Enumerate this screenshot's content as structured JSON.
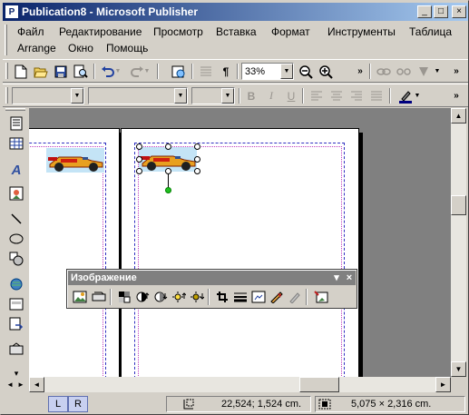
{
  "window": {
    "title": "Publication8 - Microsoft Publisher",
    "app_icon": "publisher-icon",
    "controls": {
      "minimize": "_",
      "maximize": "□",
      "close": "×"
    }
  },
  "menu": {
    "items": [
      "Файл",
      "Редактирование",
      "Просмотр",
      "Вставка",
      "Формат",
      "Инструменты",
      "Таблица",
      "Arrange",
      "Окно",
      "Помощь"
    ]
  },
  "standard_toolbar": {
    "zoom": "33%",
    "icons": [
      "new-icon",
      "open-icon",
      "save-icon",
      "print-preview-icon",
      "undo-icon",
      "redo-icon",
      "web-preview-icon",
      "columns-icon",
      "pilcrow-icon",
      "zoom-out-icon",
      "zoom-in-icon",
      "more-icon",
      "link-icon",
      "unlink-icon",
      "text-connect-icon"
    ]
  },
  "formatting_toolbar": {
    "style_value": "",
    "font_value": "",
    "size_value": "",
    "bold": "B",
    "italic": "I",
    "underline": "U"
  },
  "picture_toolbar": {
    "title": "Изображение",
    "menu_arrow": "▾",
    "close": "×"
  },
  "statusbar": {
    "page_tab_left": "L",
    "page_tab_right": "R",
    "position": "22,524; 1,524 cm.",
    "size": "5,075 × 2,316 cm."
  },
  "colors": {
    "title_start": "#0a246a",
    "title_end": "#a6caf0",
    "workspace": "#808080",
    "guide": "#3030c0",
    "rotate_handle": "#00c000"
  }
}
